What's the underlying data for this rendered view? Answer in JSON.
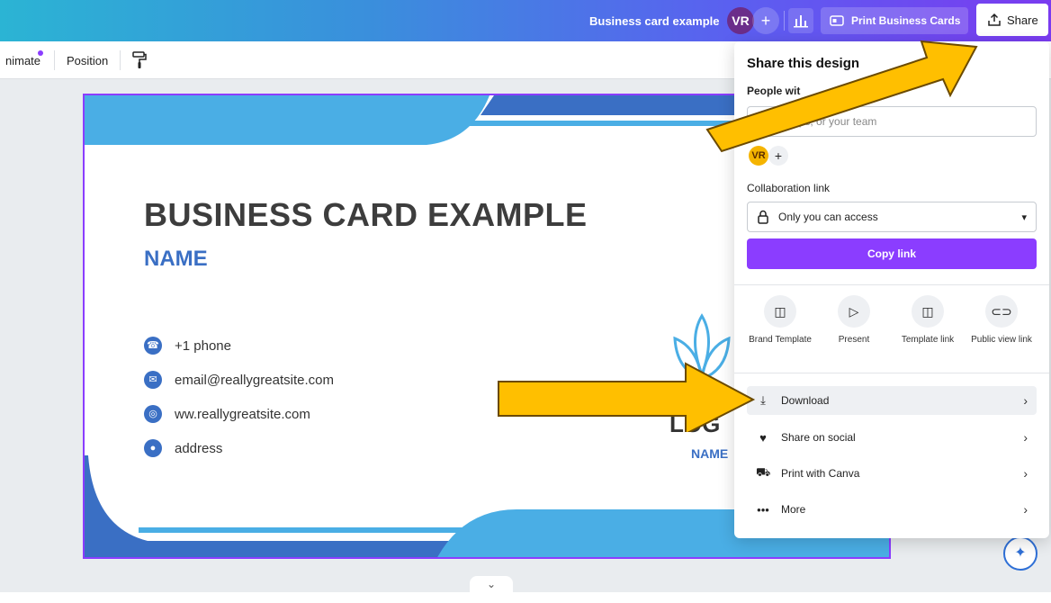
{
  "topbar": {
    "doc_title": "Business card example",
    "avatar": "VR",
    "plus": "+",
    "print_label": "Print Business Cards",
    "share_label": "Share"
  },
  "toolbar": {
    "animate_label": "nimate",
    "position_label": "Position"
  },
  "card": {
    "title": "BUSINESS CARD EXAMPLE",
    "name": "NAME",
    "contacts": [
      {
        "icon": "phone-icon",
        "text": "+1 phone"
      },
      {
        "icon": "email-icon",
        "text": "email@reallygreatsite.com"
      },
      {
        "icon": "globe-icon",
        "text": "ww.reallygreatsite.com"
      },
      {
        "icon": "location-icon",
        "text": "address"
      }
    ],
    "logo_text": "LOG",
    "logo_name": "NAME",
    "colors": {
      "primary_blue": "#3a6fc4",
      "light_blue": "#4aaee5",
      "selection_purple": "#8b3dff"
    }
  },
  "share_panel": {
    "title": "Share this design",
    "people_label": "People wit",
    "people_placeholder": "ple, groups, or your team",
    "avatar": "VR",
    "avatar_plus": "+",
    "collab_label": "Collaboration link",
    "access_value": "Only you can access",
    "copy_label": "Copy link",
    "options": [
      {
        "icon": "brand-template-icon",
        "label": "Brand Template"
      },
      {
        "icon": "present-icon",
        "label": "Present"
      },
      {
        "icon": "template-link-icon",
        "label": "Template link"
      },
      {
        "icon": "link-icon",
        "label": "Public view link"
      }
    ],
    "rows": [
      {
        "icon": "download-icon",
        "label": "Download"
      },
      {
        "icon": "heart-icon",
        "label": "Share on social"
      },
      {
        "icon": "truck-icon",
        "label": "Print with Canva"
      },
      {
        "icon": "more-icon",
        "label": "More"
      }
    ],
    "accent": "#8b3dff"
  },
  "annotation": {
    "arrow_color": "#ffbf00"
  }
}
